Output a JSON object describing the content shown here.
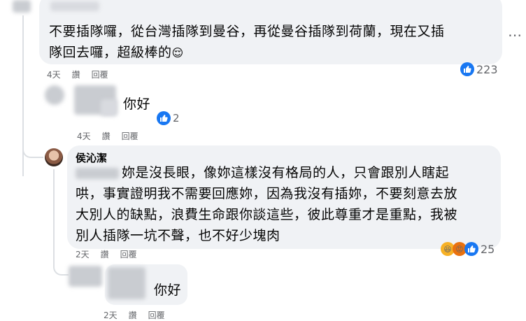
{
  "comments": [
    {
      "text_lines": [
        "不要插隊囉，從台灣插隊到曼谷，再從曼谷插隊到荷蘭，現在又插",
        "隊回去囉，超級棒的"
      ],
      "emoji": "😌",
      "time": "4天",
      "reply_label": "讚",
      "respond_label": "回覆",
      "reaction_count": "223"
    },
    {
      "text": "你好",
      "time": "4天",
      "reply_label": "讚",
      "respond_label": "回覆",
      "reaction_count": "2"
    },
    {
      "author": "侯沁潔",
      "text_lines": [
        "妳是沒長眼，像妳這樣沒有格局的人，只會跟別人瞎起",
        "哄，事實證明我不需要回應妳，因為我沒有插妳，不要刻意去放",
        "大別人的缺點，浪費生命跟你談這些，彼此尊重才是重點，我被",
        "別人插隊一坑不聲，也不好少塊肉"
      ],
      "time": "2天",
      "reply_label": "讚",
      "respond_label": "回覆",
      "reaction_count": "25"
    },
    {
      "text": "你好",
      "time": "2天",
      "reply_label": "讚",
      "respond_label": "回覆"
    }
  ],
  "more_icon": "more-horizontal-icon",
  "colors": {
    "like": "#1877f2",
    "bubble": "#f0f2f5",
    "meta": "#65676b"
  }
}
